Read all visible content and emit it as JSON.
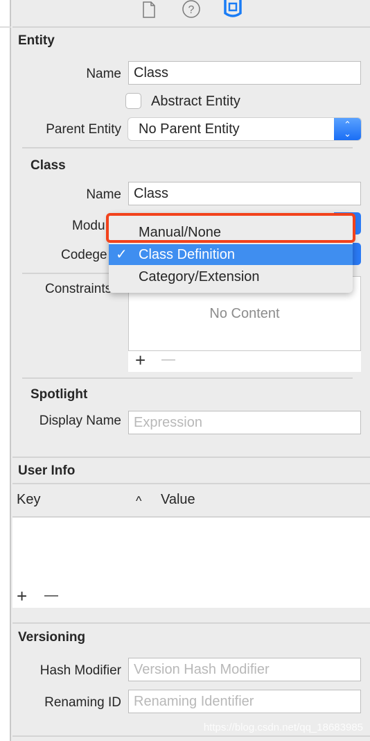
{
  "toolbar": {
    "icons": [
      "file-icon",
      "help-icon",
      "data-model-inspector-icon"
    ],
    "accent": "#1a7cf5"
  },
  "entity": {
    "title": "Entity",
    "name_label": "Name",
    "name_value": "Class",
    "abstract_label": "Abstract Entity",
    "abstract_checked": false,
    "parent_label": "Parent Entity",
    "parent_value": "No Parent Entity"
  },
  "class": {
    "title": "Class",
    "name_label": "Name",
    "name_value": "Class",
    "module_label": "Modu",
    "codegen_label": "Codege",
    "constraints_label": "Constraints",
    "no_content": "No Content"
  },
  "menu": {
    "items": [
      {
        "label": "Manual/None",
        "checked": false
      },
      {
        "label": "Class Definition",
        "checked": true
      },
      {
        "label": "Category/Extension",
        "checked": false
      }
    ],
    "check": "✓",
    "highlight_color": "#f2421c"
  },
  "spotlight": {
    "title": "Spotlight",
    "display_label": "Display Name",
    "display_placeholder": "Expression"
  },
  "userinfo": {
    "title": "User Info",
    "col_key": "Key",
    "col_value": "Value",
    "sort": "^"
  },
  "versioning": {
    "title": "Versioning",
    "hash_label": "Hash Modifier",
    "hash_placeholder": "Version Hash Modifier",
    "renaming_label": "Renaming ID",
    "renaming_placeholder": "Renaming Identifier"
  },
  "controls": {
    "add": "+",
    "remove": "—"
  },
  "watermark": "https://blog.csdn.net/qq_18683985"
}
